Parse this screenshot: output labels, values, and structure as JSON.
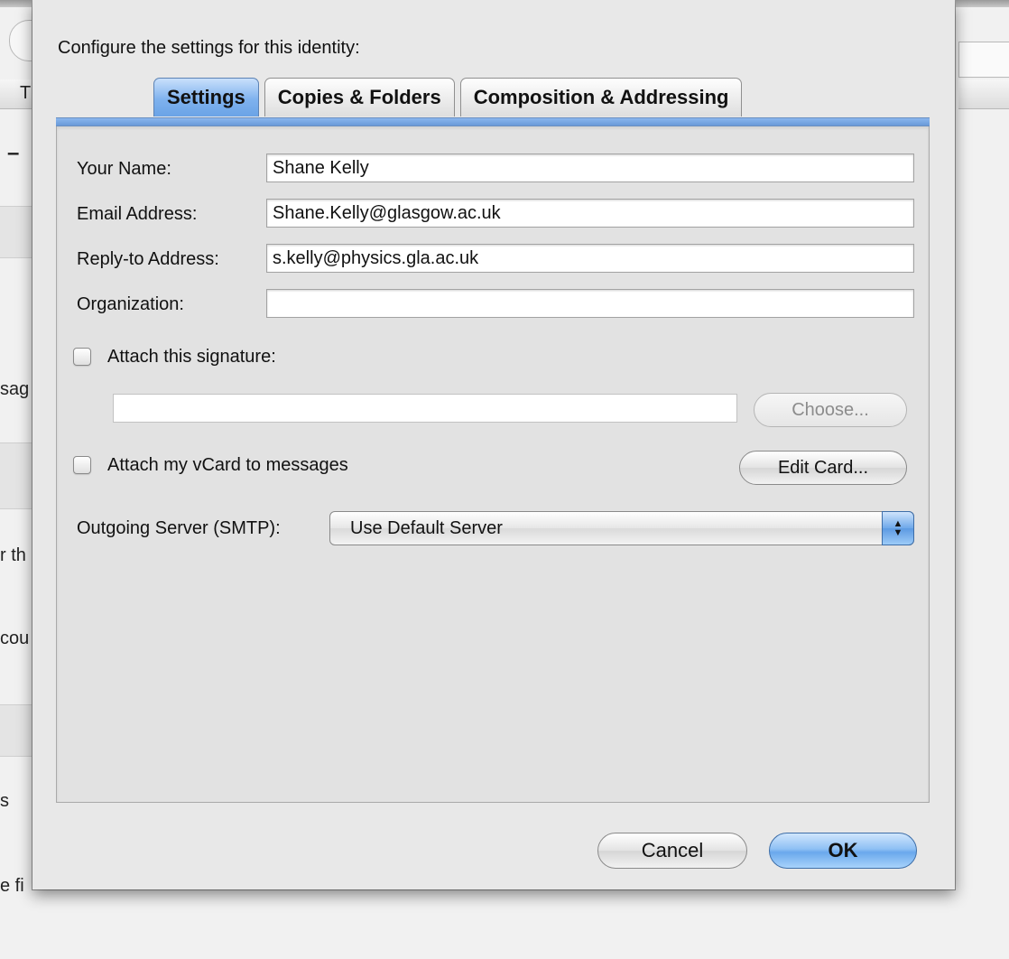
{
  "background": {
    "partial_labels": [
      "T",
      "–",
      "sag",
      "r th",
      "cou",
      "s",
      "e fi"
    ]
  },
  "dialog": {
    "caption": "Configure the settings for this identity:",
    "tabs": [
      {
        "label": "Settings",
        "active": true
      },
      {
        "label": "Copies & Folders",
        "active": false
      },
      {
        "label": "Composition & Addressing",
        "active": false
      }
    ],
    "fields": {
      "your_name": {
        "label": "Your Name:",
        "value": "Shane Kelly"
      },
      "email": {
        "label": "Email Address:",
        "value": "Shane.Kelly@glasgow.ac.uk"
      },
      "reply_to": {
        "label": "Reply-to Address:",
        "value": "s.kelly@physics.gla.ac.uk"
      },
      "organization": {
        "label": "Organization:",
        "value": ""
      }
    },
    "signature": {
      "label": "Attach this signature:",
      "checked": false,
      "path": "",
      "choose_label": "Choose..."
    },
    "vcard": {
      "label": "Attach my vCard to messages",
      "checked": false,
      "edit_label": "Edit Card..."
    },
    "smtp": {
      "label": "Outgoing Server (SMTP):",
      "selected": "Use Default Server"
    },
    "buttons": {
      "cancel": "Cancel",
      "ok": "OK"
    }
  },
  "colors": {
    "accent_blue": "#6aa3e6",
    "tab_line": "#7ea9e3",
    "panel_bg": "#e2e2e2"
  }
}
